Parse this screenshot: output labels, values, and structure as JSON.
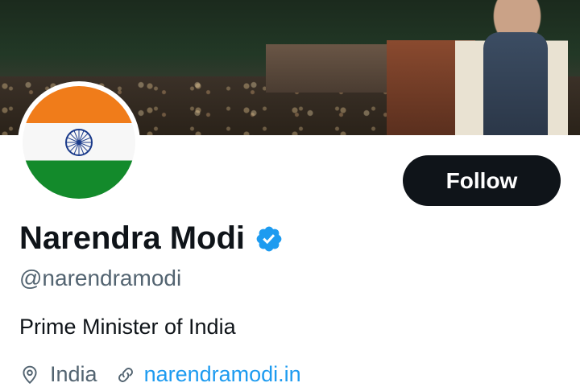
{
  "profile": {
    "name": "Narendra Modi",
    "handle": "@narendramodi",
    "bio": "Prime Minister of India",
    "location": "India",
    "website": "narendramodi.in"
  },
  "actions": {
    "follow_label": "Follow"
  },
  "icons": {
    "verified": "verified-badge-icon",
    "location": "location-pin-icon",
    "link": "link-icon"
  },
  "colors": {
    "follow_bg": "#0f1419",
    "verified_blue": "#1d9bf0",
    "link_blue": "#1d9bf0",
    "secondary_text": "#536471"
  }
}
